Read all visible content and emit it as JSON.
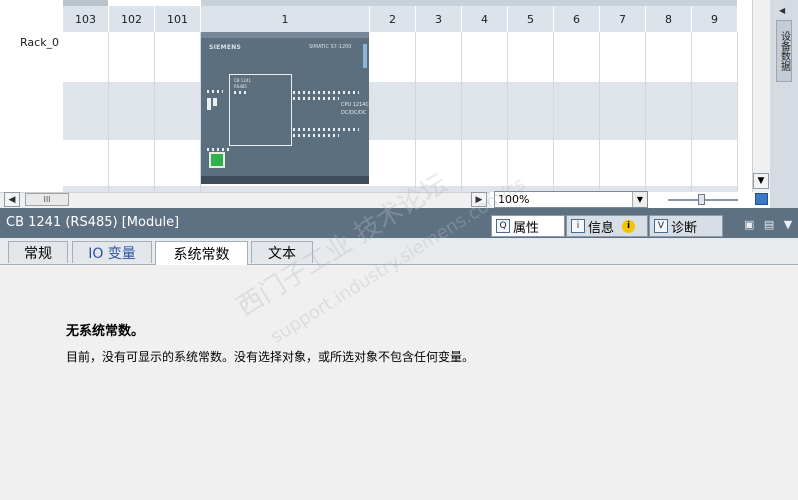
{
  "rack": {
    "label": "Rack_0",
    "slots": [
      "103",
      "102",
      "101",
      "1",
      "2",
      "3",
      "4",
      "5",
      "6",
      "7",
      "8",
      "9"
    ],
    "cpu": {
      "brand": "SIEMENS",
      "series": "SIMATIC S7-1200",
      "board_line1": "CB 1241",
      "board_line2": "RS485",
      "model_line1": "CPU 1214C",
      "model_line2": "DC/DC/DC"
    }
  },
  "view": {
    "zoom": "100%",
    "scroll_thumb": "III",
    "side_tab": "设备数据"
  },
  "inspector": {
    "title": "CB 1241 (RS485) [Module]",
    "tabs": {
      "properties": "属性",
      "info": "信息",
      "diagnostics": "诊断"
    },
    "subtabs": {
      "general": "常规",
      "io_tags": "IO 变量",
      "system_constants": "系统常数",
      "texts": "文本"
    },
    "message_title": "无系统常数。",
    "message_body": "目前，没有可显示的系统常数。没有选择对象，或所选对象不包含任何变量。"
  },
  "watermark": {
    "line1": "西门子工业 技术论坛",
    "line2": "support.industry.siemens.com/cs"
  },
  "colors": {
    "inspector_bar": "#5d7183",
    "slot_header": "#dde3ea",
    "cpu_body": "#5c6f7e",
    "status_led": "#2fb24a"
  }
}
